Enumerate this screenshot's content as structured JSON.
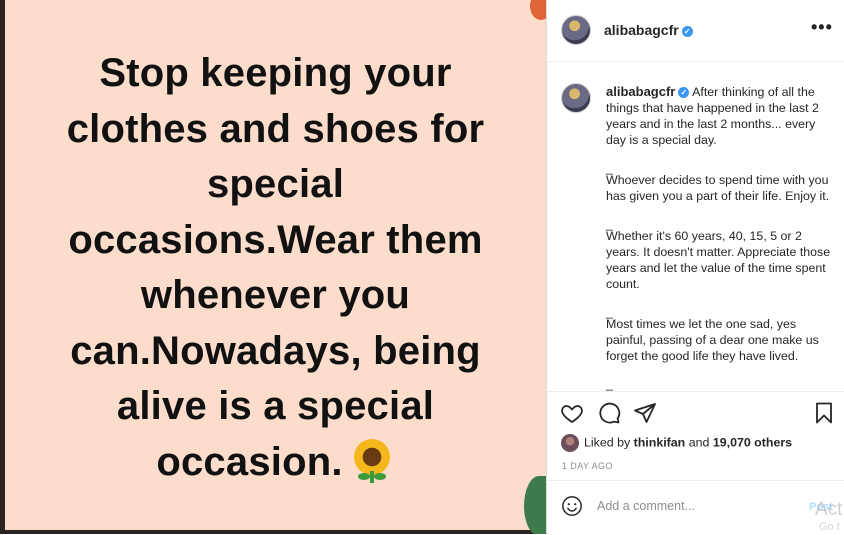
{
  "post": {
    "quote_lines": [
      "Stop keeping your",
      "clothes and shoes for",
      "special",
      "occasions.Wear them",
      "whenever you",
      "can.Nowadays, being",
      "alive is a special",
      "occasion."
    ],
    "emoji": "sunflower"
  },
  "header": {
    "username": "alibabagcfr",
    "more_label": "•••"
  },
  "caption": {
    "username": "alibabagcfr",
    "paragraphs": [
      "After thinking of all the things that have happened in the last 2 years and in the last 2 months... every day is a special day.",
      "Whoever decides to spend time with you has given you a part of their life. Enjoy it.",
      "Whether it's 60 years, 40, 15, 5 or 2 years. It doesn't matter. Appreciate those years and let the value of the time spent count.",
      "Most times we let the one sad, yes painful, passing of a dear one make us forget the good life they have lived."
    ],
    "separator": "_"
  },
  "likes": {
    "prefix": "Liked by",
    "user": "thinkifan",
    "and": "and",
    "count": "19,070 others"
  },
  "timestamp": "1 DAY AGO",
  "comment": {
    "placeholder": "Add a comment...",
    "post_label": "Post",
    "watermark": "Act",
    "watermark2": "Go t"
  },
  "icons": {
    "like": "heart-icon",
    "comment": "comment-icon",
    "share": "paper-plane-icon",
    "save": "bookmark-icon",
    "emoji": "smiley-icon",
    "verified": "verified-badge-icon"
  },
  "colors": {
    "accent": "#3897f0",
    "image_bg": "#fcdccb",
    "post_btn_disabled": "#b2dffc"
  }
}
